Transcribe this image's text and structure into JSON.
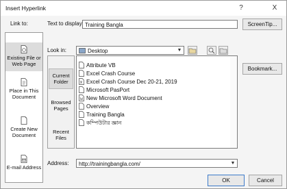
{
  "window": {
    "title": "Insert Hyperlink",
    "help": "?",
    "close": "X"
  },
  "link_to": {
    "label": "Link to:",
    "items": [
      {
        "label": "Existing File or Web Page",
        "icon": "globe-file-icon",
        "selected": true
      },
      {
        "label": "Place in This Document",
        "icon": "document-icon",
        "selected": false
      },
      {
        "label": "Create New Document",
        "icon": "new-document-icon",
        "selected": false
      },
      {
        "label": "E-mail Address",
        "icon": "email-icon",
        "selected": false
      }
    ]
  },
  "text_to_display": {
    "label": "Text to display:",
    "value": "Training Bangla"
  },
  "screentip_button": "ScreenTip...",
  "look_in": {
    "label": "Look in:",
    "value": "Desktop"
  },
  "side_buttons": [
    {
      "label": "Current Folder",
      "selected": true
    },
    {
      "label": "Browsed Pages",
      "selected": false
    },
    {
      "label": "Recent Files",
      "selected": false
    }
  ],
  "files": [
    {
      "name": "Attribute VB",
      "icon": "file-icon"
    },
    {
      "name": "Excel Crash Course",
      "icon": "file-icon"
    },
    {
      "name": "Excel Crash Course Dec 20-21, 2019",
      "icon": "excel-file-icon"
    },
    {
      "name": "Microsoft PasPort",
      "icon": "file-icon"
    },
    {
      "name": "New Microsoft Word Document",
      "icon": "word-file-icon"
    },
    {
      "name": "Overview",
      "icon": "file-icon"
    },
    {
      "name": "Training Bangla",
      "icon": "file-icon"
    },
    {
      "name": "কম্পিউটার জ্ঞান",
      "icon": "file-icon"
    }
  ],
  "bookmark_button": "Bookmark...",
  "address": {
    "label": "Address:",
    "value": "http://trainingbangla.com/"
  },
  "ok_button": "OK",
  "cancel_button": "Cancel",
  "colors": {
    "accent": "#3b79c9",
    "dialog_bg": "#f4f4f4",
    "selected_bg": "#dcdcdc"
  }
}
